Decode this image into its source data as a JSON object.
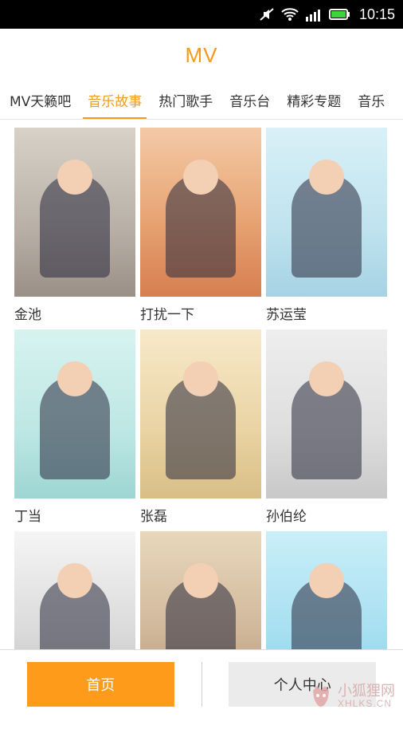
{
  "status_bar": {
    "time": "10:15",
    "icons": [
      "mute-icon",
      "wifi-icon",
      "signal-icon",
      "battery-icon"
    ]
  },
  "app_title": "MV",
  "tabs": [
    {
      "label": "MV天籁吧",
      "active": false
    },
    {
      "label": "音乐故事",
      "active": true
    },
    {
      "label": "热门歌手",
      "active": false
    },
    {
      "label": "音乐台",
      "active": false
    },
    {
      "label": "精彩专题",
      "active": false
    },
    {
      "label": "音乐",
      "active": false
    }
  ],
  "grid": {
    "items": [
      {
        "label": "金池"
      },
      {
        "label": "打扰一下"
      },
      {
        "label": "苏运莹"
      },
      {
        "label": "丁当"
      },
      {
        "label": "张磊"
      },
      {
        "label": "孙伯纶"
      },
      {
        "label": ""
      },
      {
        "label": ""
      },
      {
        "label": ""
      }
    ]
  },
  "bottom_nav": {
    "home_label": "首页",
    "profile_label": "个人中心"
  },
  "watermark": {
    "cn": "小狐狸网",
    "en": "XHLKS.CN"
  },
  "colors": {
    "accent": "#f39a1e",
    "home_button_bg": "#ff9b1a",
    "profile_button_bg": "#ebebeb"
  }
}
